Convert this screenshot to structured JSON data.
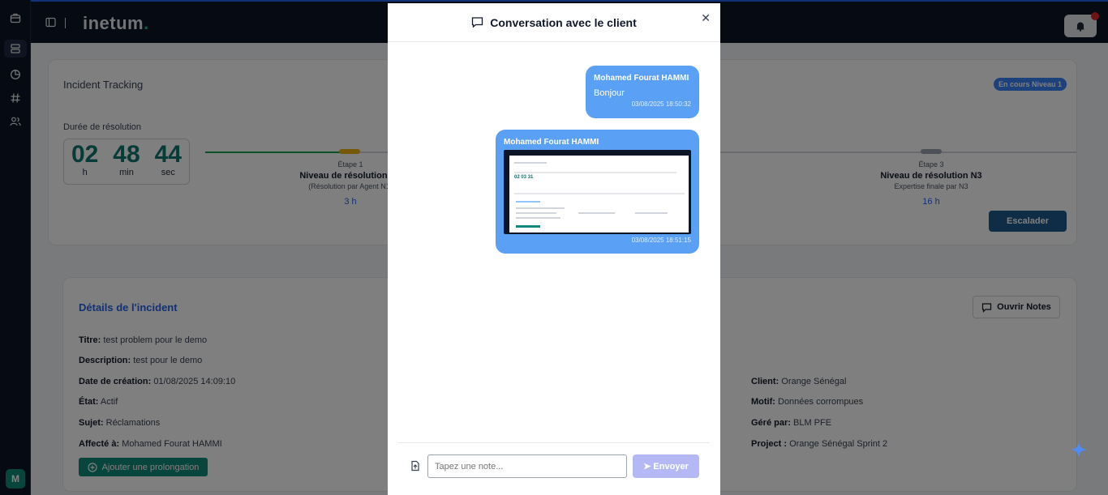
{
  "brand": {
    "name": "inetum",
    "dot": "."
  },
  "user": {
    "initial": "M"
  },
  "tracking": {
    "title": "Incident Tracking",
    "status": "En cours Niveau 1",
    "duration_label": "Durée de résolution",
    "timer": [
      {
        "value": "02",
        "unit": "h"
      },
      {
        "value": "48",
        "unit": "min"
      },
      {
        "value": "44",
        "unit": "sec"
      }
    ],
    "steps": [
      {
        "step": "Étape 1",
        "level": "Niveau de résolution N1",
        "desc": "(Résolution par Agent N1)",
        "time": "3 h"
      },
      {
        "step": "Étape 3",
        "level": "Niveau de résolution N3",
        "desc": "Expertise finale par N3",
        "time": "16 h"
      }
    ],
    "escalate": "Escalader"
  },
  "details": {
    "title": "Détails de l'incident",
    "notes_button": "Ouvrir Notes",
    "left": [
      {
        "label": "Titre:",
        "value": "test problem pour le demo"
      },
      {
        "label": "Description:",
        "value": "test pour le demo"
      },
      {
        "label": "Date de création:",
        "value": "01/08/2025 14:09:10"
      },
      {
        "label": "État:",
        "value": "Actif"
      },
      {
        "label": "Sujet:",
        "value": "Réclamations"
      },
      {
        "label": "Affecté à:",
        "value": "Mohamed Fourat HAMMI"
      }
    ],
    "right": [
      {
        "label": "Client:",
        "value": "Orange Sénégal"
      },
      {
        "label": "Motif:",
        "value": "Données corrompues"
      },
      {
        "label": "Géré par:",
        "value": "BLM PFE"
      },
      {
        "label": "Project :",
        "value": "Orange Sénégal Sprint 2"
      }
    ],
    "prolong_button": "Ajouter une prolongation"
  },
  "modal": {
    "title": "Conversation avec le client",
    "messages": [
      {
        "from": "Mohamed Fourat HAMMI",
        "text": "Bonjour",
        "time": "03/08/2025 18:50:32"
      },
      {
        "from": "Mohamed Fourat HAMMI",
        "text": "",
        "attachment": "screenshot",
        "time": "03/08/2025 18:51:15"
      }
    ],
    "input_placeholder": "Tapez une note...",
    "send_label": "➤ Envoyer"
  }
}
